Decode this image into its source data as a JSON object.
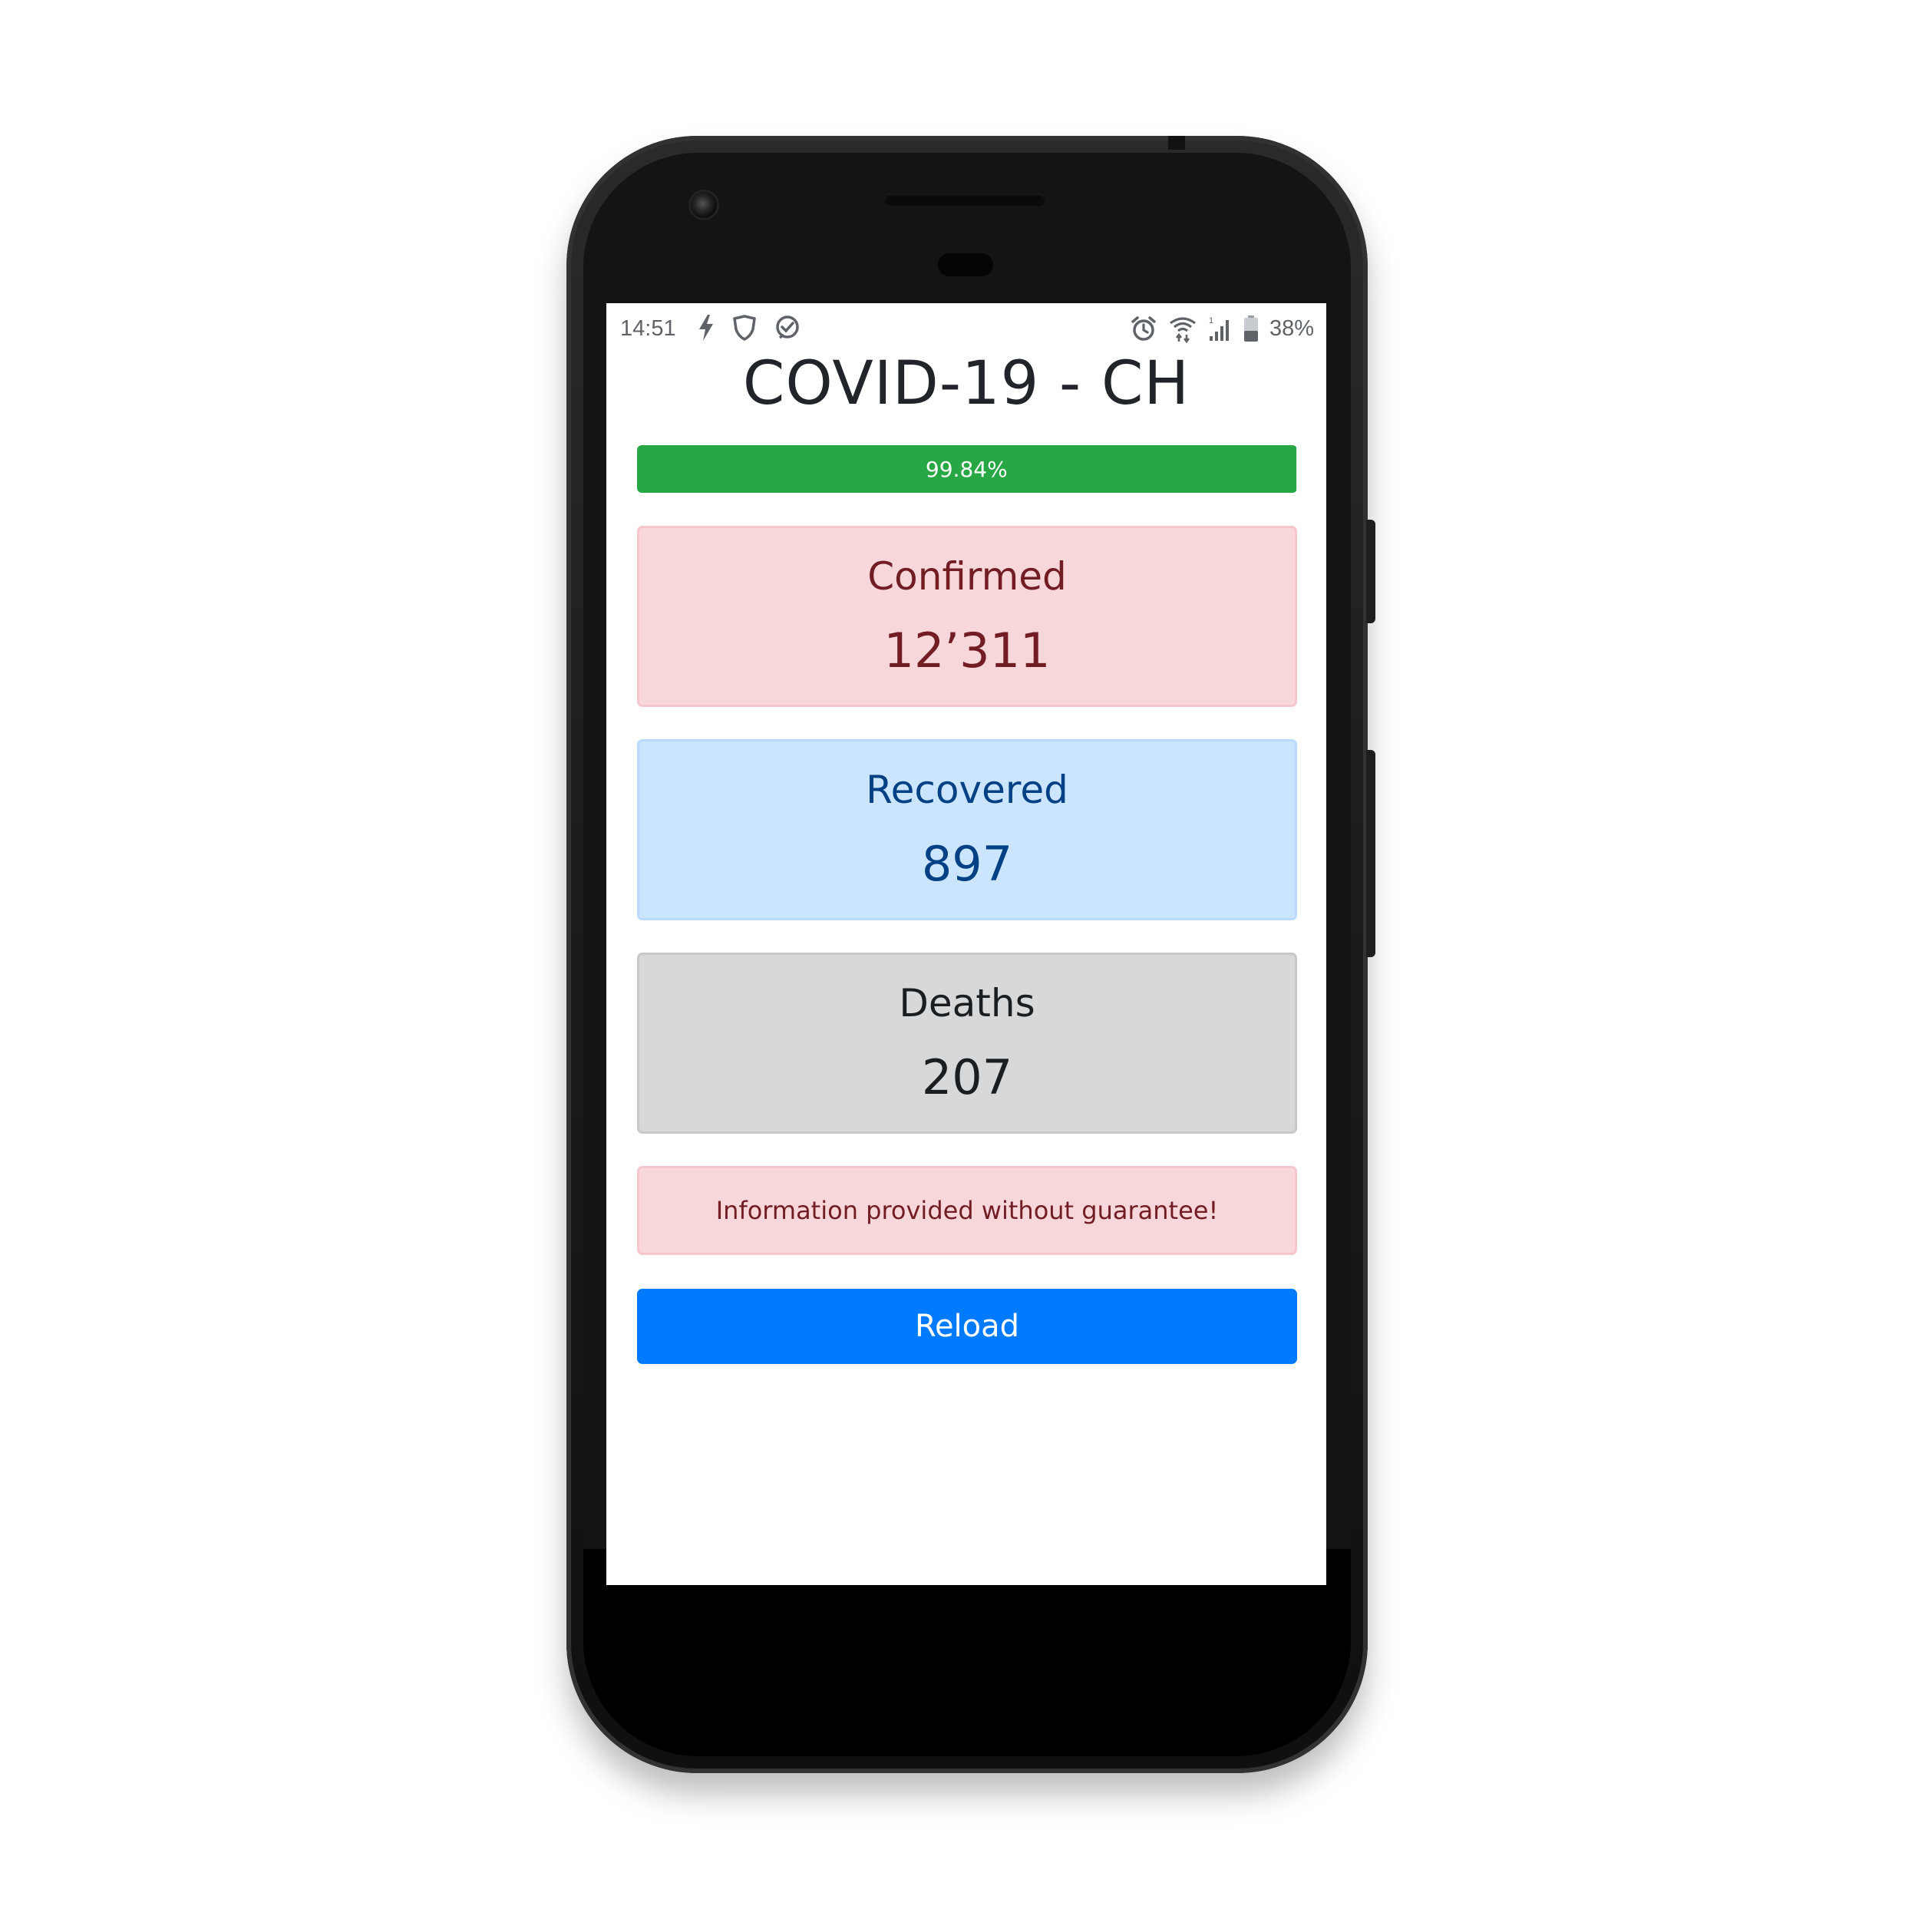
{
  "status_bar": {
    "time": "14:51",
    "battery_percent": "38%",
    "left_icons": [
      "flash-icon",
      "shield-icon",
      "clock-check-icon"
    ],
    "right_icons": [
      "alarm-icon",
      "wifi-icon",
      "signal-icon",
      "battery-icon"
    ]
  },
  "app": {
    "title": "COVID-19 - CH"
  },
  "progress": {
    "label": "99.84%",
    "value": 0.9984,
    "color": "#28a745"
  },
  "stats": {
    "confirmed": {
      "label": "Confirmed",
      "value": "12’311",
      "color": "#721c24"
    },
    "recovered": {
      "label": "Recovered",
      "value": "897",
      "color": "#004085"
    },
    "deaths": {
      "label": "Deaths",
      "value": "207",
      "color": "#1b1e21"
    }
  },
  "disclaimer": {
    "text": "Information provided without guarantee!"
  },
  "actions": {
    "reload_label": "Reload",
    "reload_color": "#007bff"
  }
}
